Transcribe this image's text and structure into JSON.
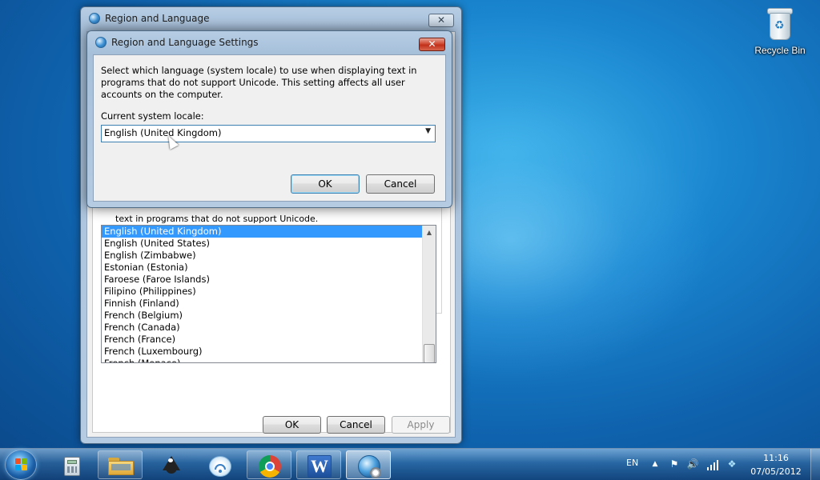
{
  "desktop": {
    "recycle_bin_label": "Recycle Bin"
  },
  "back_window": {
    "title": "Region and Language",
    "close_glyph": "✕",
    "partial_description": "text in programs that do not support Unicode.",
    "locale_list": [
      "English (United Kingdom)",
      "English (United States)",
      "English (Zimbabwe)",
      "Estonian (Estonia)",
      "Faroese (Faroe Islands)",
      "Filipino (Philippines)",
      "Finnish (Finland)",
      "French (Belgium)",
      "French (Canada)",
      "French (France)",
      "French (Luxembourg)",
      "French (Monaco)"
    ],
    "selected_index": 0,
    "buttons": {
      "ok": "OK",
      "cancel": "Cancel",
      "apply": "Apply"
    }
  },
  "front_window": {
    "title": "Region and Language Settings",
    "close_glyph": "✕",
    "description": "Select which language (system locale) to use when displaying text in programs that do not support Unicode. This setting affects all user accounts on the computer.",
    "current_locale_label": "Current system locale:",
    "current_locale_value": "English (United Kingdom)",
    "buttons": {
      "ok": "OK",
      "cancel": "Cancel"
    }
  },
  "taskbar": {
    "pinned": [
      {
        "name": "calculator-icon"
      },
      {
        "name": "file-explorer-icon"
      },
      {
        "name": "inkscape-icon"
      },
      {
        "name": "wifi-icon"
      },
      {
        "name": "chrome-icon"
      },
      {
        "name": "word-icon",
        "glyph": "W"
      },
      {
        "name": "region-language-icon"
      }
    ],
    "tray": {
      "language": "EN",
      "time": "11:16",
      "date": "07/05/2012"
    }
  },
  "colors": {
    "selection": "#3399ff",
    "close_red": "#c2301a",
    "desktop_blue": "#1a86d0"
  }
}
